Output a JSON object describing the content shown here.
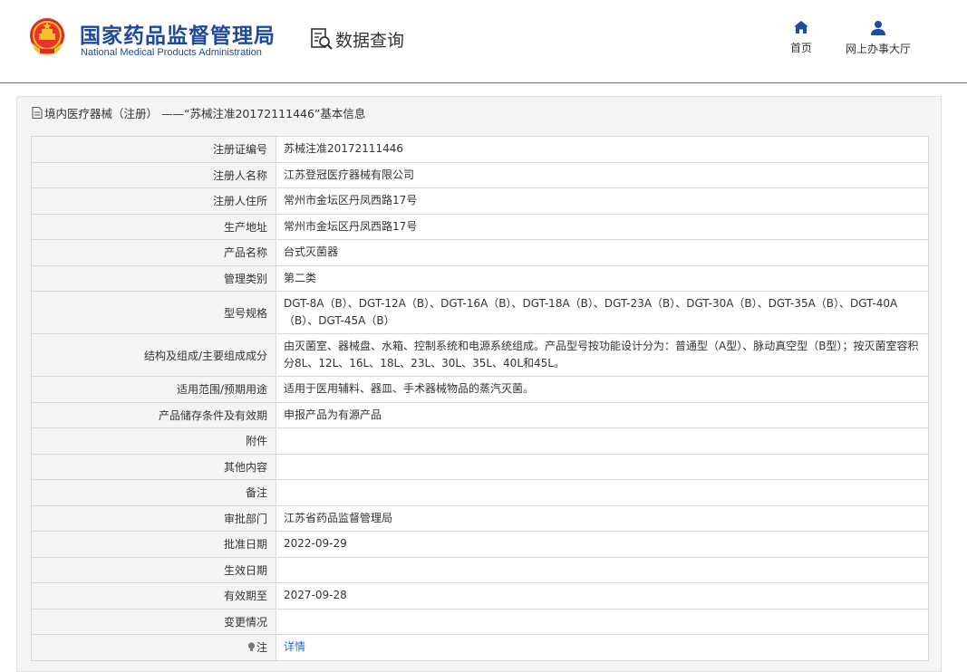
{
  "header": {
    "title_cn": "国家药品监督管理局",
    "title_en": "National Medical Products Administration",
    "query_label": "数据查询",
    "nav": [
      {
        "label": "首页",
        "icon": "home-icon"
      },
      {
        "label": "网上办事大厅",
        "icon": "user-icon"
      }
    ]
  },
  "panel": {
    "title": "境内医疗器械（注册） ——“苏械注准20172111446”基本信息"
  },
  "rows": [
    {
      "label": "注册证编号",
      "value": "苏械注准20172111446"
    },
    {
      "label": "注册人名称",
      "value": "江苏登冠医疗器械有限公司"
    },
    {
      "label": "注册人住所",
      "value": "常州市金坛区丹凤西路17号"
    },
    {
      "label": "生产地址",
      "value": "常州市金坛区丹凤西路17号"
    },
    {
      "label": "产品名称",
      "value": "台式灭菌器"
    },
    {
      "label": "管理类别",
      "value": "第二类"
    },
    {
      "label": "型号规格",
      "value": "DGT-8A（B）、DGT-12A（B）、DGT-16A（B）、DGT-18A（B）、DGT-23A（B）、DGT-30A（B）、DGT-35A（B）、DGT-40A（B）、DGT-45A（B）"
    },
    {
      "label": "结构及组成/主要组成成分",
      "value": "由灭菌室、器械盘、水箱、控制系统和电源系统组成。产品型号按功能设计分为：普通型（A型）、脉动真空型（B型）；按灭菌室容积分8L、12L、16L、18L、23L、30L、35L、40L和45L。"
    },
    {
      "label": "适用范围/预期用途",
      "value": "适用于医用辅料、器皿、手术器械物品的蒸汽灭菌。"
    },
    {
      "label": "产品储存条件及有效期",
      "value": "申报产品为有源产品"
    },
    {
      "label": "附件",
      "value": ""
    },
    {
      "label": "其他内容",
      "value": ""
    },
    {
      "label": "备注",
      "value": ""
    },
    {
      "label": "审批部门",
      "value": "江苏省药品监督管理局"
    },
    {
      "label": "批准日期",
      "value": "2022-09-29"
    },
    {
      "label": "生效日期",
      "value": ""
    },
    {
      "label": "有效期至",
      "value": "2027-09-28"
    },
    {
      "label": "变更情况",
      "value": ""
    },
    {
      "label": "注",
      "value": "详情",
      "icon": "lightbulb-icon"
    }
  ],
  "colors": {
    "brand": "#1d4a9c",
    "link": "#1f6fc1",
    "header_rule": "#3b7fc4"
  }
}
